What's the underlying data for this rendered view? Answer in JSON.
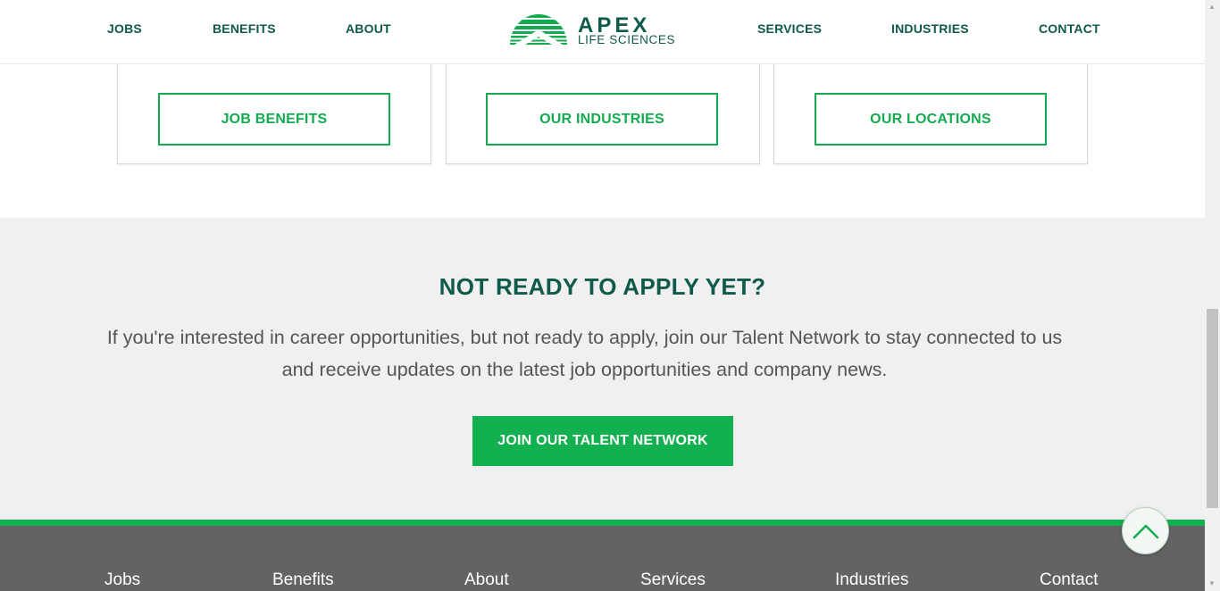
{
  "header": {
    "nav_left": [
      "JOBS",
      "BENEFITS",
      "ABOUT"
    ],
    "nav_right": [
      "SERVICES",
      "INDUSTRIES",
      "CONTACT"
    ],
    "logo": {
      "word": "APEX",
      "sub": "LIFE SCIENCES"
    }
  },
  "cards": {
    "buttons": [
      "JOB BENEFITS",
      "OUR INDUSTRIES",
      "OUR LOCATIONS"
    ]
  },
  "talent": {
    "title": "NOT READY TO APPLY YET?",
    "body": "If you're interested in career opportunities, but not ready to apply, join our Talent Network to stay connected to us and receive updates on the latest job opportunities and company news.",
    "button": "JOIN OUR TALENT NETWORK"
  },
  "footer": {
    "links": [
      "Jobs",
      "Benefits",
      "About",
      "Services",
      "Industries",
      "Contact"
    ]
  },
  "icons": {
    "back_to_top": "chevron-up-icon",
    "scroll_up": "triangle-up",
    "scroll_down": "triangle-down"
  },
  "colors": {
    "brand_dark": "#0f5a4a",
    "brand_green": "#13b04f",
    "section_bg": "#eff0ef",
    "footer_bg": "#636365"
  }
}
